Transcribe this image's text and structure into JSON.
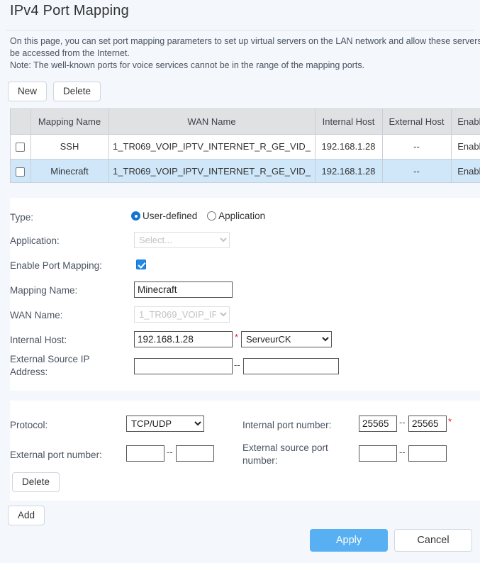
{
  "header": {
    "title": "IPv4 Port Mapping",
    "intro_line1": "On this page, you can set port mapping parameters to set up virtual servers on the LAN network and allow these servers to",
    "intro_line2": "be accessed from the Internet.",
    "intro_line3": "Note: The well-known ports for voice services cannot be in the range of the mapping ports."
  },
  "toolbar": {
    "new_label": "New",
    "delete_label": "Delete"
  },
  "table": {
    "columns": [
      "",
      "Mapping Name",
      "WAN Name",
      "Internal Host",
      "External Host",
      "Enable"
    ],
    "rows": [
      {
        "selected": false,
        "mapping_name": "SSH",
        "wan_name": "1_TR069_VOIP_IPTV_INTERNET_R_GE_VID_",
        "internal_host": "192.168.1.28",
        "external_host": "--",
        "enable": "Enable"
      },
      {
        "selected": true,
        "mapping_name": "Minecraft",
        "wan_name": "1_TR069_VOIP_IPTV_INTERNET_R_GE_VID_",
        "internal_host": "192.168.1.28",
        "external_host": "--",
        "enable": "Enable"
      }
    ]
  },
  "form": {
    "type_label": "Type:",
    "type_option_user": "User-defined",
    "type_option_app": "Application",
    "type_selected": "User-defined",
    "application_label": "Application:",
    "application_value": "Select...",
    "enable_port_mapping_label": "Enable Port Mapping:",
    "enable_port_mapping_checked": true,
    "mapping_name_label": "Mapping Name:",
    "mapping_name_value": "Minecraft",
    "wan_name_label": "WAN Name:",
    "wan_name_value": "1_TR069_VOIP_IP",
    "internal_host_label": "Internal Host:",
    "internal_host_value": "192.168.1.28",
    "internal_host_required": "*",
    "internal_host_device": "ServeurCK",
    "external_source_ip_label_line1": "External Source IP",
    "external_source_ip_label_line2": "Address:",
    "external_source_ip_start": "",
    "external_source_ip_end": "",
    "range_separator": "--"
  },
  "ports": {
    "protocol_label": "Protocol:",
    "protocol_value": "TCP/UDP",
    "internal_port_label": "Internal port number:",
    "internal_port_start": "25565",
    "internal_port_end": "25565",
    "internal_port_required": "*",
    "external_port_label": "External port number:",
    "external_port_start": "",
    "external_port_end": "",
    "external_source_port_label_line1": "External source port",
    "external_source_port_label_line2": "number:",
    "external_source_port_start": "",
    "external_source_port_end": "",
    "delete_label": "Delete",
    "range_separator": "--"
  },
  "footer": {
    "add_label": "Add",
    "apply_label": "Apply",
    "cancel_label": "Cancel"
  },
  "colors": {
    "page_bg": "#f4f7fb",
    "accent": "#58b0f3",
    "row_selected": "#cfe7f9",
    "table_header": "#e0e1e2",
    "required": "#e8192c"
  }
}
